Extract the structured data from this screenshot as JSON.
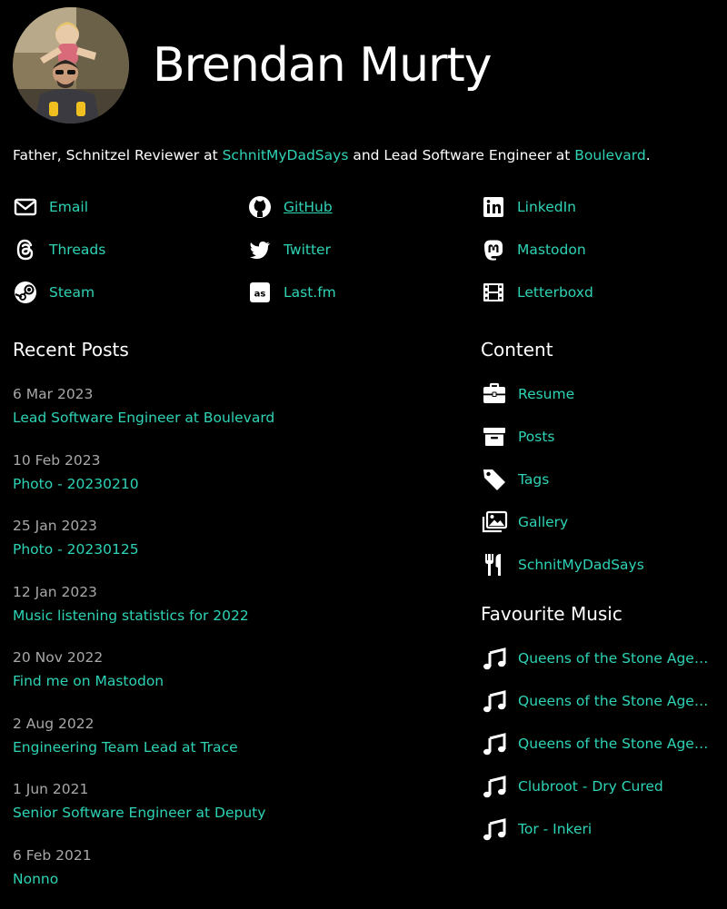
{
  "profile": {
    "name": "Brendan Murty",
    "bio": {
      "prefix": "Father, Schnitzel Reviewer at ",
      "link1": "SchnitMyDadSays",
      "middle": " and Lead Software Engineer at ",
      "link2": "Boulevard",
      "suffix": "."
    }
  },
  "socials": [
    {
      "label": "Email",
      "icon": "envelope-icon"
    },
    {
      "label": "GitHub",
      "icon": "github-icon"
    },
    {
      "label": "LinkedIn",
      "icon": "linkedin-icon"
    },
    {
      "label": "Threads",
      "icon": "threads-icon"
    },
    {
      "label": "Twitter",
      "icon": "twitter-icon"
    },
    {
      "label": "Mastodon",
      "icon": "mastodon-icon"
    },
    {
      "label": "Steam",
      "icon": "steam-icon"
    },
    {
      "label": "Last.fm",
      "icon": "lastfm-icon"
    },
    {
      "label": "Letterboxd",
      "icon": "film-icon"
    }
  ],
  "recent_posts": {
    "heading": "Recent Posts",
    "items": [
      {
        "date": "6 Mar 2023",
        "title": "Lead Software Engineer at Boulevard"
      },
      {
        "date": "10 Feb 2023",
        "title": "Photo - 20230210"
      },
      {
        "date": "25 Jan 2023",
        "title": "Photo - 20230125"
      },
      {
        "date": "12 Jan 2023",
        "title": "Music listening statistics for 2022"
      },
      {
        "date": "20 Nov 2022",
        "title": "Find me on Mastodon"
      },
      {
        "date": "2 Aug 2022",
        "title": "Engineering Team Lead at Trace"
      },
      {
        "date": "1 Jun 2021",
        "title": "Senior Software Engineer at Deputy"
      },
      {
        "date": "6 Feb 2021",
        "title": "Nonno"
      }
    ]
  },
  "content": {
    "heading": "Content",
    "items": [
      {
        "label": "Resume",
        "icon": "briefcase-icon"
      },
      {
        "label": "Posts",
        "icon": "archive-box-icon"
      },
      {
        "label": "Tags",
        "icon": "tag-icon"
      },
      {
        "label": "Gallery",
        "icon": "images-icon"
      },
      {
        "label": "SchnitMyDadSays",
        "icon": "utensils-icon"
      }
    ]
  },
  "music": {
    "heading": "Favourite Music",
    "items": [
      {
        "label": "Queens of the Stone Age ...",
        "icon": "music-note-icon"
      },
      {
        "label": "Queens of the Stone Age ...",
        "icon": "music-note-icon"
      },
      {
        "label": "Queens of the Stone Age ...",
        "icon": "music-note-icon"
      },
      {
        "label": "Clubroot - Dry Cured",
        "icon": "music-note-icon"
      },
      {
        "label": "Tor - Inkeri",
        "icon": "music-note-icon"
      }
    ]
  },
  "colors": {
    "background": "#000000",
    "link": "#2ed3b6",
    "date": "#a8a8a8"
  }
}
